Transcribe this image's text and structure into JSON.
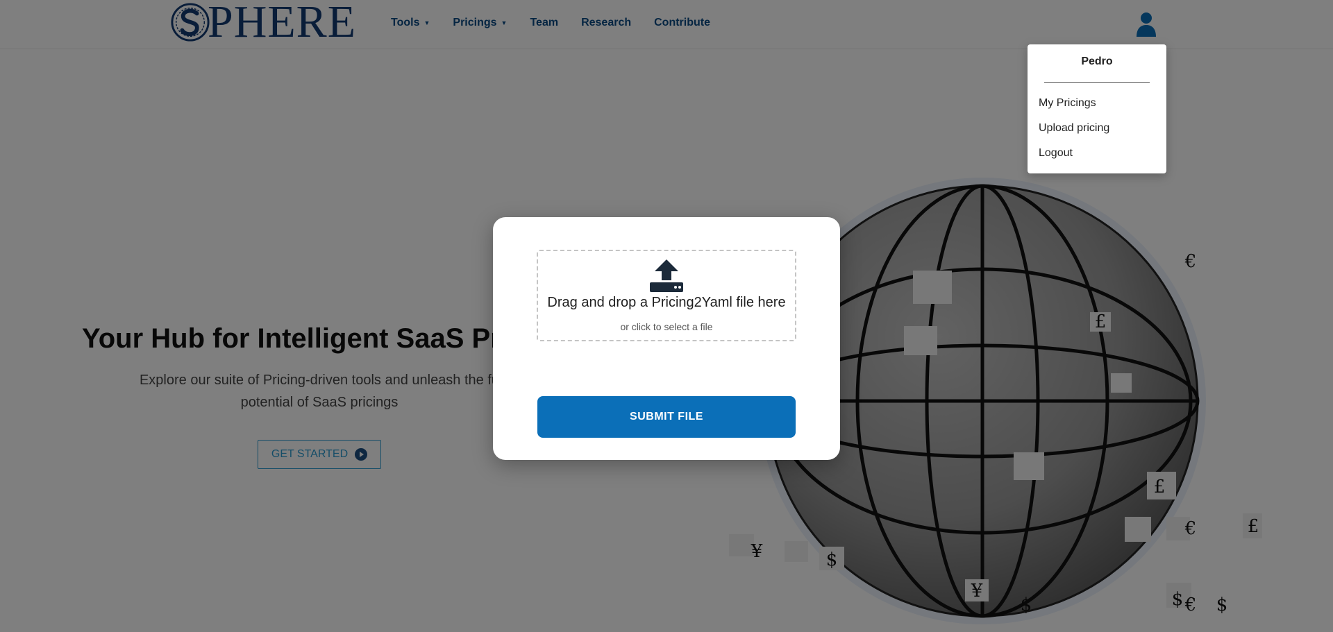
{
  "header": {
    "logo_text": "PHERE",
    "nav": [
      {
        "label": "Tools",
        "dropdown": true
      },
      {
        "label": "Pricings",
        "dropdown": true
      },
      {
        "label": "Team",
        "dropdown": false
      },
      {
        "label": "Research",
        "dropdown": false
      },
      {
        "label": "Contribute",
        "dropdown": false
      }
    ],
    "user_icon": "user-icon"
  },
  "user_menu": {
    "name": "Pedro",
    "items": [
      "My Pricings",
      "Upload pricing",
      "Logout"
    ]
  },
  "hero": {
    "title": "Your Hub for Intelligent SaaS Pr",
    "subtitle_line1": "Explore our suite of Pricing-driven tools and unleash the fu",
    "subtitle_line2": "potential of SaaS pricings",
    "cta_label": "GET STARTED",
    "cta_icon": "play-circle-icon"
  },
  "globe_labels": [
    "€",
    "£",
    "¥",
    "$",
    "€",
    "£",
    "$",
    "¥",
    "$",
    "€",
    "$",
    "£"
  ],
  "upload_modal": {
    "icon": "upload-icon",
    "drop_title": "Drag and drop a Pricing2Yaml file here",
    "drop_sub": "or click to select a file",
    "submit_label": "SUBMIT FILE"
  },
  "colors": {
    "brand": "#123a73",
    "nav": "#0a4a85",
    "accent": "#0b6fb8",
    "cta": "#2a9bd0"
  }
}
